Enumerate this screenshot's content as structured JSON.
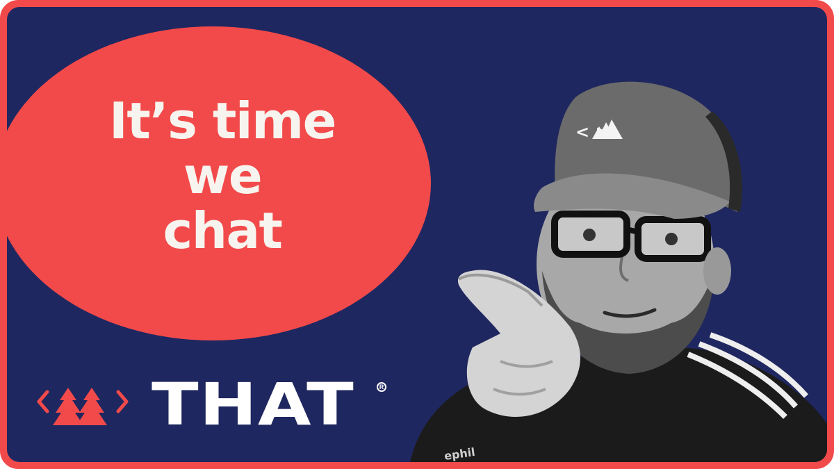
{
  "headline": {
    "line1": "It’s time",
    "line2": "we",
    "line3": "chat"
  },
  "brand": {
    "wordmark": "THAT",
    "registered_mark": "R",
    "cap_logo": "<  >"
  },
  "colors": {
    "accent": "#f24a4a",
    "background": "#1f2760",
    "text": "#f7f4ef"
  },
  "photo": {
    "shirt_text": "ephil"
  }
}
